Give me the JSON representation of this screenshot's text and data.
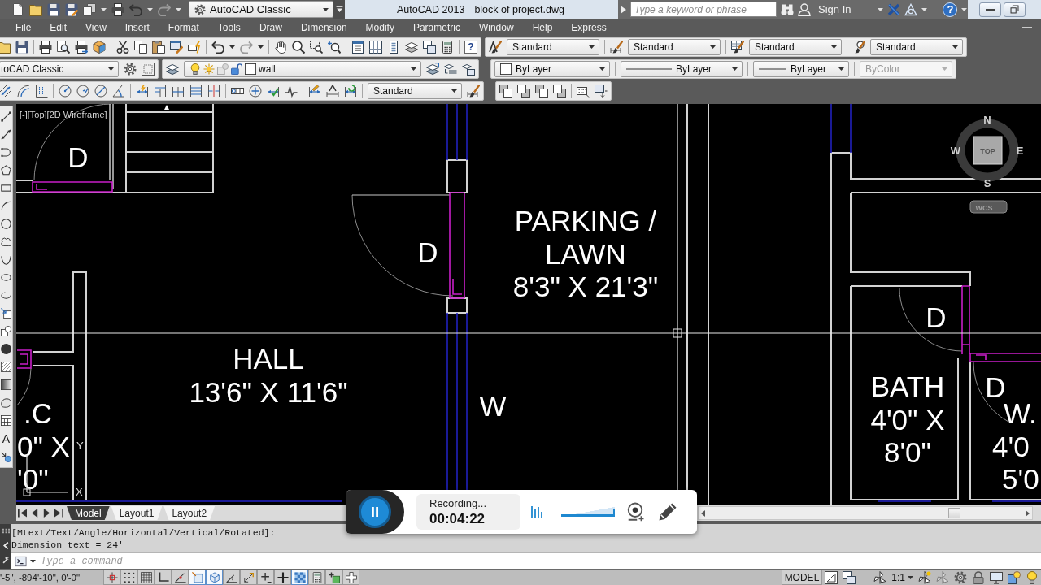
{
  "title_bar": {
    "workspace": "AutoCAD Classic",
    "app_name": "AutoCAD 2013",
    "file_name": "block of project.dwg",
    "search": {
      "placeholder": "Type a keyword or phrase"
    },
    "sign_in": "Sign In",
    "help": "?"
  },
  "menu_bar": [
    "File",
    "Edit",
    "View",
    "Insert",
    "Format",
    "Tools",
    "Draw",
    "Dimension",
    "Modify",
    "Parametric",
    "Window",
    "Help",
    "Express"
  ],
  "standard_toolbar": {
    "help": "?"
  },
  "styles_toolbar": [
    "Standard",
    "Standard",
    "Standard",
    "Standard"
  ],
  "workspaces_toolbar": {
    "value": "toCAD Classic"
  },
  "layer": {
    "name": "wall",
    "on": true,
    "frozen": false,
    "locked": false
  },
  "properties_toolbar": [
    {
      "value": "ByLayer",
      "disabled": false
    },
    {
      "value": "ByLayer",
      "disabled": false
    },
    {
      "value": "ByLayer",
      "disabled": false
    },
    {
      "value": "ByColor",
      "disabled": true
    }
  ],
  "dimension_toolbar": {
    "style": "Standard"
  },
  "draw_toolbar": {
    "text_tool": "A"
  },
  "viewport": {
    "controls": "[-][Top][2D Wireframe]",
    "room_labels": [
      {
        "lines": [
          "PARKING /",
          "LAWN",
          "8'3\" X 21'3\""
        ]
      },
      {
        "lines": [
          "HALL",
          "13'6\" X 11'6\""
        ]
      },
      {
        "lines": [
          "BATH",
          "4'0\" X",
          "8'0\""
        ]
      },
      {
        "lines": [
          ".C",
          "0\" X",
          "'0\""
        ]
      },
      {
        "lines": [
          "W.",
          "4'0",
          "5'0"
        ]
      }
    ],
    "tags": [
      "D",
      "D",
      "D",
      "D",
      "W"
    ],
    "ucs_icon": {
      "y_axis": "Y",
      "x_axis": "X"
    }
  },
  "view_cube": {
    "north": "N",
    "west": "W",
    "face": "TOP",
    "east": "E",
    "south": "S",
    "ucs": "WCS"
  },
  "layout_tabs": [
    {
      "label": "Model",
      "selected": true
    },
    {
      "label": "Layout1",
      "selected": false
    },
    {
      "label": "Layout2",
      "selected": false
    }
  ],
  "recorder": {
    "status": "Recording...",
    "elapsed": "00:04:22",
    "volume": {
      "level": 1
    }
  },
  "command_history": [
    "[Mtext/Text/Angle/Horizontal/Vertical/Rotated]:",
    "Dimension text = 24'"
  ],
  "command_line": {
    "placeholder": "Type a command"
  },
  "status_bar": {
    "coordinates": "'-5\", -894'-10\", 0'-0\"",
    "toggles": [
      {
        "on": false
      },
      {
        "on": false
      },
      {
        "on": false
      },
      {
        "on": false
      },
      {
        "on": false
      },
      {
        "on": true
      },
      {
        "on": true
      },
      {
        "on": false
      },
      {
        "on": false
      },
      {
        "on": false
      },
      {
        "on": false
      },
      {
        "on": true
      },
      {
        "on": false
      },
      {
        "on": false
      },
      {
        "on": false
      }
    ],
    "model": "MODEL",
    "annotation_scale": "1:1"
  }
}
